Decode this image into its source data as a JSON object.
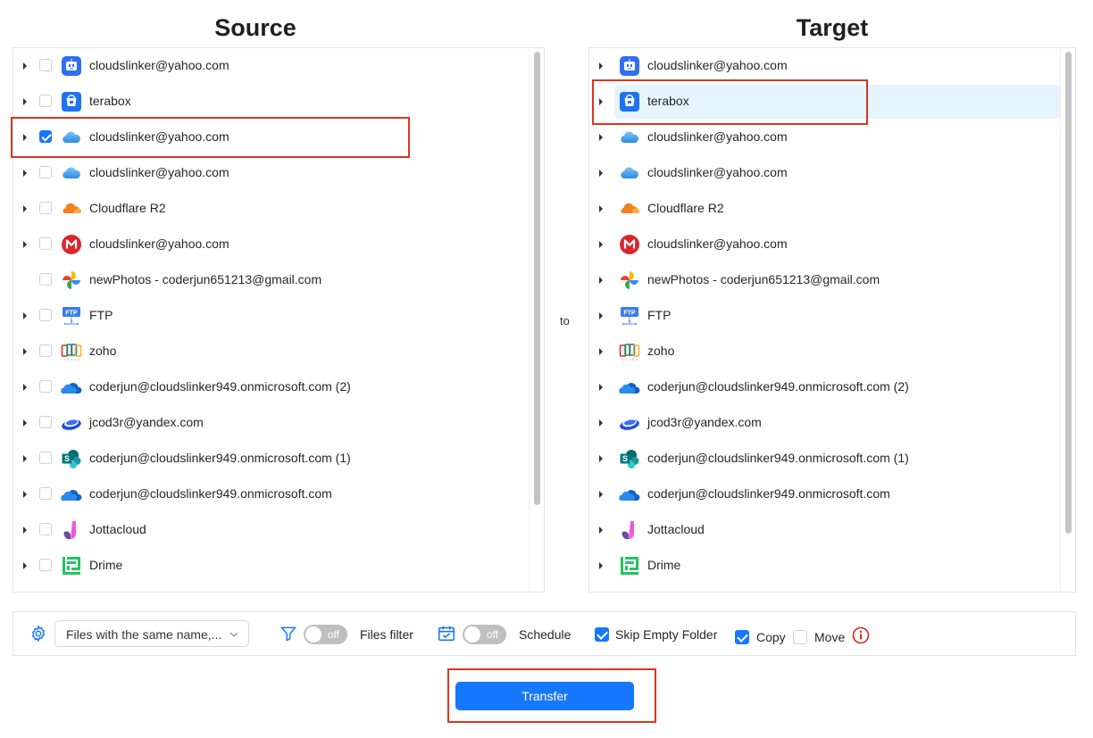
{
  "source": {
    "title": "Source",
    "items": [
      {
        "label": "cloudslinker@yahoo.com",
        "icon": "box-icon",
        "checked": false,
        "expandable": true
      },
      {
        "label": "terabox",
        "icon": "terabox-icon",
        "checked": false,
        "expandable": true
      },
      {
        "label": "cloudslinker@yahoo.com",
        "icon": "icloud-icon",
        "checked": true,
        "expandable": true
      },
      {
        "label": "cloudslinker@yahoo.com",
        "icon": "icloud-icon",
        "checked": false,
        "expandable": true
      },
      {
        "label": "Cloudflare R2",
        "icon": "cloudflare-icon",
        "checked": false,
        "expandable": true
      },
      {
        "label": "cloudslinker@yahoo.com",
        "icon": "mega-icon",
        "checked": false,
        "expandable": true
      },
      {
        "label": "newPhotos - coderjun651213@gmail.com",
        "icon": "google-photos-icon",
        "checked": false,
        "expandable": false
      },
      {
        "label": "FTP",
        "icon": "ftp-icon",
        "checked": false,
        "expandable": true
      },
      {
        "label": "zoho",
        "icon": "zoho-icon",
        "checked": false,
        "expandable": true
      },
      {
        "label": "coderjun@cloudslinker949.onmicrosoft.com (2)",
        "icon": "onedrive-icon",
        "checked": false,
        "expandable": true
      },
      {
        "label": "jcod3r@yandex.com",
        "icon": "yandex-disk-icon",
        "checked": false,
        "expandable": true
      },
      {
        "label": "coderjun@cloudslinker949.onmicrosoft.com (1)",
        "icon": "sharepoint-icon",
        "checked": false,
        "expandable": true
      },
      {
        "label": "coderjun@cloudslinker949.onmicrosoft.com",
        "icon": "onedrive-icon",
        "checked": false,
        "expandable": true
      },
      {
        "label": "Jottacloud",
        "icon": "jottacloud-icon",
        "checked": false,
        "expandable": true
      },
      {
        "label": "Drime",
        "icon": "drime-icon",
        "checked": false,
        "expandable": true
      }
    ]
  },
  "target": {
    "title": "Target",
    "selected_index": 1,
    "items": [
      {
        "label": "cloudslinker@yahoo.com",
        "icon": "box-icon"
      },
      {
        "label": "terabox",
        "icon": "terabox-icon"
      },
      {
        "label": "cloudslinker@yahoo.com",
        "icon": "icloud-icon"
      },
      {
        "label": "cloudslinker@yahoo.com",
        "icon": "icloud-icon"
      },
      {
        "label": "Cloudflare R2",
        "icon": "cloudflare-icon"
      },
      {
        "label": "cloudslinker@yahoo.com",
        "icon": "mega-icon"
      },
      {
        "label": "newPhotos - coderjun651213@gmail.com",
        "icon": "google-photos-icon"
      },
      {
        "label": "FTP",
        "icon": "ftp-icon"
      },
      {
        "label": "zoho",
        "icon": "zoho-icon"
      },
      {
        "label": "coderjun@cloudslinker949.onmicrosoft.com (2)",
        "icon": "onedrive-icon"
      },
      {
        "label": "jcod3r@yandex.com",
        "icon": "yandex-disk-icon"
      },
      {
        "label": "coderjun@cloudslinker949.onmicrosoft.com (1)",
        "icon": "sharepoint-icon"
      },
      {
        "label": "coderjun@cloudslinker949.onmicrosoft.com",
        "icon": "onedrive-icon"
      },
      {
        "label": "Jottacloud",
        "icon": "jottacloud-icon"
      },
      {
        "label": "Drime",
        "icon": "drime-icon"
      }
    ]
  },
  "connector": "to",
  "options": {
    "conflict_select": "Files with the same name,...",
    "files_filter": {
      "toggle": "off",
      "label": "Files filter"
    },
    "schedule": {
      "toggle": "off",
      "label": "Schedule"
    },
    "skip_empty_folder": {
      "label": "Skip Empty Folder",
      "checked": true
    },
    "copy": {
      "label": "Copy",
      "checked": true
    },
    "move": {
      "label": "Move",
      "checked": false
    }
  },
  "transfer_button": "Transfer",
  "colors": {
    "accent": "#1677ff",
    "highlight": "#d9361e",
    "selected_row": "#e6f4ff"
  }
}
